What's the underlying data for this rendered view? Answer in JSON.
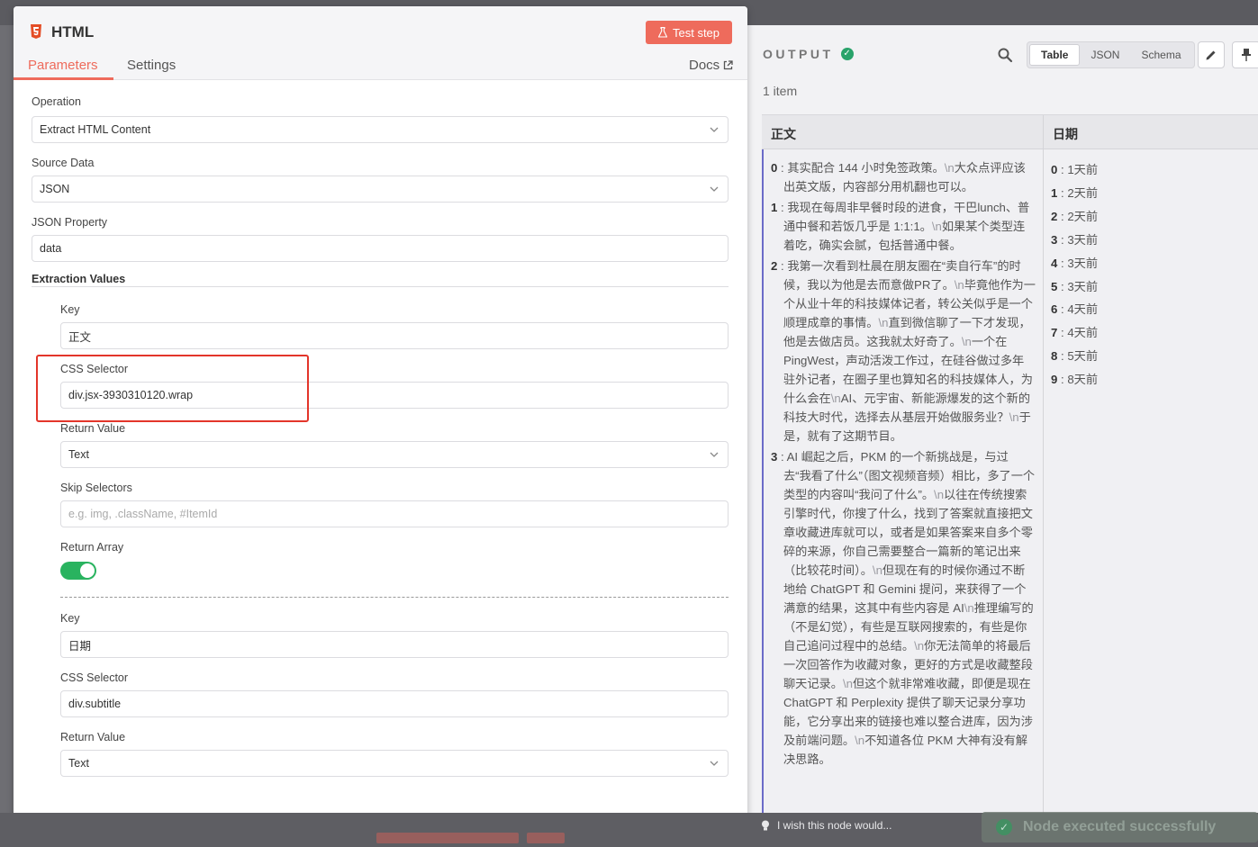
{
  "node": {
    "title": "HTML",
    "test_step_label": "Test step",
    "tabs": [
      "Parameters",
      "Settings"
    ],
    "docs_label": "Docs",
    "accent_color": "#ee6b5c"
  },
  "params": {
    "operation": {
      "label": "Operation",
      "value": "Extract HTML Content"
    },
    "source_data": {
      "label": "Source Data",
      "value": "JSON"
    },
    "json_property": {
      "label": "JSON Property",
      "value": "data"
    },
    "extraction_values_label": "Extraction Values",
    "entries": [
      {
        "key_label": "Key",
        "key_value": "正文",
        "css_label": "CSS Selector",
        "css_value": "div.jsx-3930310120.wrap",
        "return_label": "Return Value",
        "return_value": "Text",
        "skip_label": "Skip Selectors",
        "skip_placeholder": "e.g. img, .className, #ItemId",
        "array_label": "Return Array",
        "array_on": true
      },
      {
        "key_label": "Key",
        "key_value": "日期",
        "css_label": "CSS Selector",
        "css_value": "div.subtitle",
        "return_label": "Return Value",
        "return_value": "Text"
      }
    ]
  },
  "output": {
    "title": "OUTPUT",
    "view_tabs": [
      "Table",
      "JSON",
      "Schema"
    ],
    "active_view": "Table",
    "item_count": "1 item",
    "columns": [
      "正文",
      "日期"
    ],
    "body_rows": [
      {
        "index": "0",
        "text": [
          [
            "其实配合 144 小时免签政策。",
            false
          ],
          [
            "\\n",
            true
          ],
          [
            "大众点评应该出英文版，内容部分用机翻也可以。",
            false
          ]
        ]
      },
      {
        "index": "1",
        "text": [
          [
            "我现在每周非早餐时段的进食，干巴lunch、普通中餐和若饭几乎是 1:1:1。",
            false
          ],
          [
            "\\n",
            true
          ],
          [
            "如果某个类型连着吃，确实会腻，包括普通中餐。",
            false
          ]
        ]
      },
      {
        "index": "2",
        "text": [
          [
            "我第一次看到杜晨在朋友圈在“卖自行车”的时候，我以为他是去而意做PR了。",
            false
          ],
          [
            "\\n",
            true
          ],
          [
            "毕竟他作为一个从业十年的科技媒体记者，转公关似乎是一个顺理成章的事情。",
            false
          ],
          [
            "\\n",
            true
          ],
          [
            "直到微信聊了一下才发现，他是去做店员。这我就太好奇了。",
            false
          ],
          [
            "\\n",
            true
          ],
          [
            "一个在 PingWest，声动活泼工作过，在硅谷做过多年驻外记者，在圈子里也算知名的科技媒体人，为什么会在",
            false
          ],
          [
            "\\n",
            true
          ],
          [
            "AI、元宇宙、新能源爆发的这个新的科技大时代，选择去从基层开始做服务业？",
            false
          ],
          [
            "\\n",
            true
          ],
          [
            "于是，就有了这期节目。",
            false
          ]
        ]
      },
      {
        "index": "3",
        "text": [
          [
            "AI 崛起之后，PKM 的一个新挑战是，与过去“我看了什么”（图文视频音频）相比，多了一个类型的内容叫“我问了什么”。",
            false
          ],
          [
            "\\n",
            true
          ],
          [
            "以往在传统搜索引擎时代，你搜了什么，找到了答案就直接把文章收藏进库就可以，或者是如果答案来自多个零碎的来源，你自己需要整合一篇新的笔记出来（比较花时间）。",
            false
          ],
          [
            "\\n",
            true
          ],
          [
            "但现在有的时候你通过不断地给 ChatGPT 和 Gemini 提问，来获得了一个满意的结果，这其中有些内容是 AI",
            false
          ],
          [
            "\\n",
            true
          ],
          [
            "推理编写的（不是幻觉），有些是互联网搜索的，有些是你自己追问过程中的总结。",
            false
          ],
          [
            "\\n",
            true
          ],
          [
            "你无法简单的将最后一次回答作为收藏对象，更好的方式是收藏整段聊天记录。",
            false
          ],
          [
            "\\n",
            true
          ],
          [
            "但这个就非常难收藏，即便是现在 ChatGPT 和 Perplexity 提供了聊天记录分享功能，它分享出来的链接也难以整合进库，因为涉及前端问题。",
            false
          ],
          [
            "\\n",
            true
          ],
          [
            "不知道各位 PKM 大神有没有解决思路。",
            false
          ]
        ]
      }
    ],
    "date_rows": [
      {
        "index": "0",
        "value": "1天前"
      },
      {
        "index": "1",
        "value": "2天前"
      },
      {
        "index": "2",
        "value": "2天前"
      },
      {
        "index": "3",
        "value": "3天前"
      },
      {
        "index": "4",
        "value": "3天前"
      },
      {
        "index": "5",
        "value": "3天前"
      },
      {
        "index": "6",
        "value": "4天前"
      },
      {
        "index": "7",
        "value": "4天前"
      },
      {
        "index": "8",
        "value": "5天前"
      },
      {
        "index": "9",
        "value": "8天前"
      }
    ]
  },
  "footer": {
    "wish_text": "I wish this node would...",
    "toast_text": "Node executed successfully"
  }
}
